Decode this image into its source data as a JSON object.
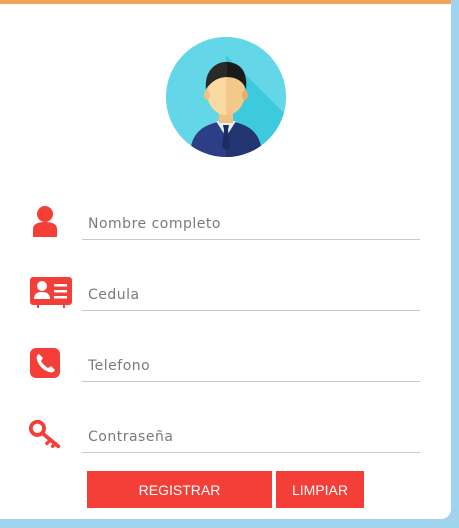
{
  "form": {
    "fields": [
      {
        "placeholder": "Nombre completo",
        "icon": "user-icon"
      },
      {
        "placeholder": "Cedula",
        "icon": "id-card-icon"
      },
      {
        "placeholder": "Telefono",
        "icon": "phone-icon"
      },
      {
        "placeholder": "Contraseña",
        "icon": "key-icon"
      }
    ],
    "register_label": "REGISTRAR",
    "clear_label": "LIMPIAR"
  },
  "colors": {
    "accent": "#f43f38",
    "top_border": "#f3a25c",
    "background": "#9fd4ee",
    "avatar_bg": "#63d6e8"
  }
}
